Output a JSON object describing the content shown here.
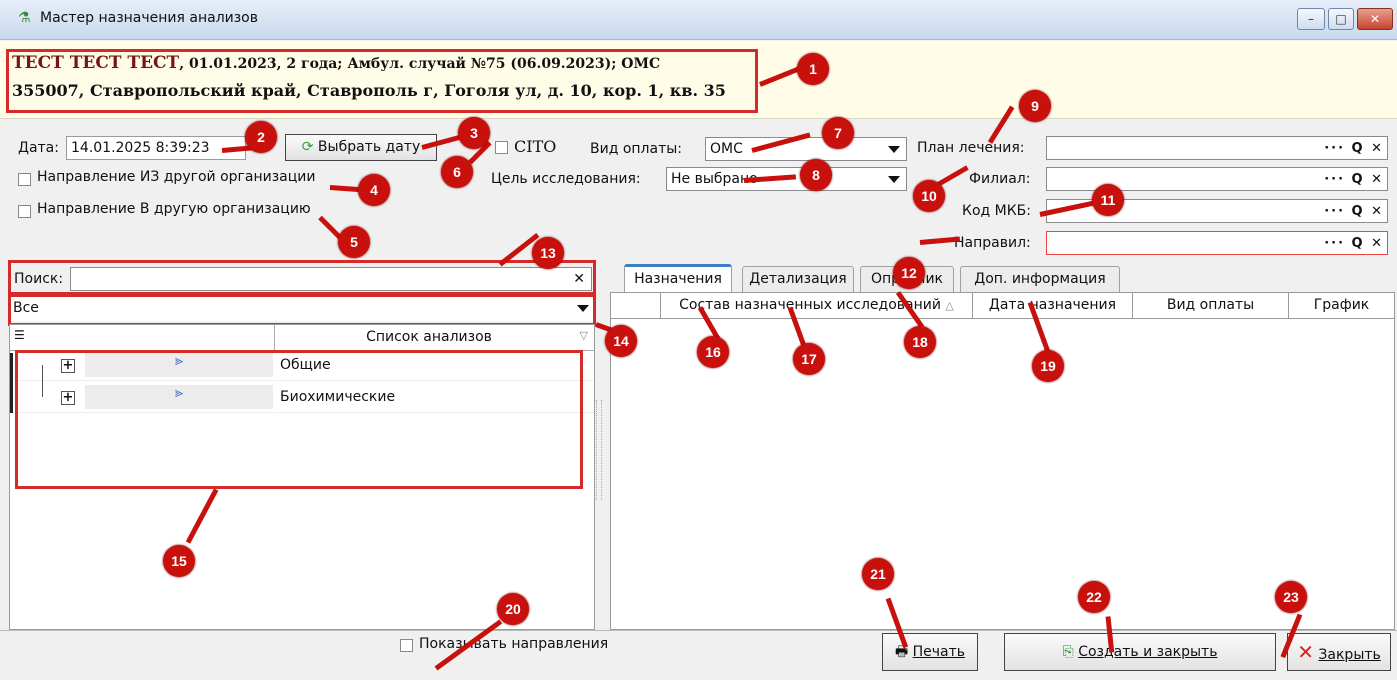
{
  "window": {
    "title": "Мастер назначения анализов",
    "btn_min": "–",
    "btn_max": "□",
    "btn_close": "✕"
  },
  "patient": {
    "name": "ТЕСТ ТЕСТ ТЕСТ",
    "info": ", 01.01.2023, 2 года; Амбул. случай №75 (06.09.2023); ОМС",
    "address": "355007, Ставропольский край, Ставрополь г, Гоголя ул, д. 10, кор. 1, кв. 35"
  },
  "form": {
    "date_label": "Дата:",
    "date_value": "14.01.2025 8:39:23",
    "choose_date_button": "Выбрать дату",
    "cito_label": "CITO",
    "payment_label": "Вид оплаты:",
    "payment_value": "ОМС",
    "purpose_label": "Цель исследования:",
    "purpose_value": "Не выбрано",
    "from_org_label": "Направление ИЗ другой организации",
    "to_org_label": "Направление В другую организацию",
    "plan_label": "План лечения:",
    "plan_value": "",
    "branch_label": "Филиал:",
    "branch_value": "",
    "mkb_label": "Код МКБ:",
    "mkb_value": "",
    "referrer_label": "Направил:",
    "referrer_value": "",
    "lookup_buttons": "··· Q ✕"
  },
  "search": {
    "label": "Поиск:",
    "value": "",
    "clear": "✕",
    "filter_value": "Все"
  },
  "tree": {
    "header": "Список анализов",
    "items": [
      {
        "label": "Общие",
        "expander": "+",
        "icon": "⪢"
      },
      {
        "label": "Биохимические",
        "expander": "+",
        "icon": "⪢"
      }
    ]
  },
  "tabs": [
    "Назначения",
    "Детализация",
    "Опросник",
    "Доп. информация"
  ],
  "grid": {
    "columns": [
      "Состав назначенных исследований",
      "Дата назначения",
      "Вид оплаты",
      "График"
    ],
    "sort_glyph": "△"
  },
  "footer": {
    "show_directions_label": "Показывать направления",
    "print_button": "Печать",
    "create_close_button": "Создать и закрыть",
    "close_button": "Закрыть"
  },
  "markers": [
    "1",
    "2",
    "3",
    "4",
    "5",
    "6",
    "7",
    "8",
    "9",
    "10",
    "11",
    "12",
    "13",
    "14",
    "15",
    "16",
    "17",
    "18",
    "19",
    "20",
    "21",
    "22",
    "23"
  ],
  "colors": {
    "marker": "#c8100c",
    "highlight": "#d42a2a",
    "patient_bg": "#fffde8",
    "tab_accent": "#3c7fc7"
  }
}
